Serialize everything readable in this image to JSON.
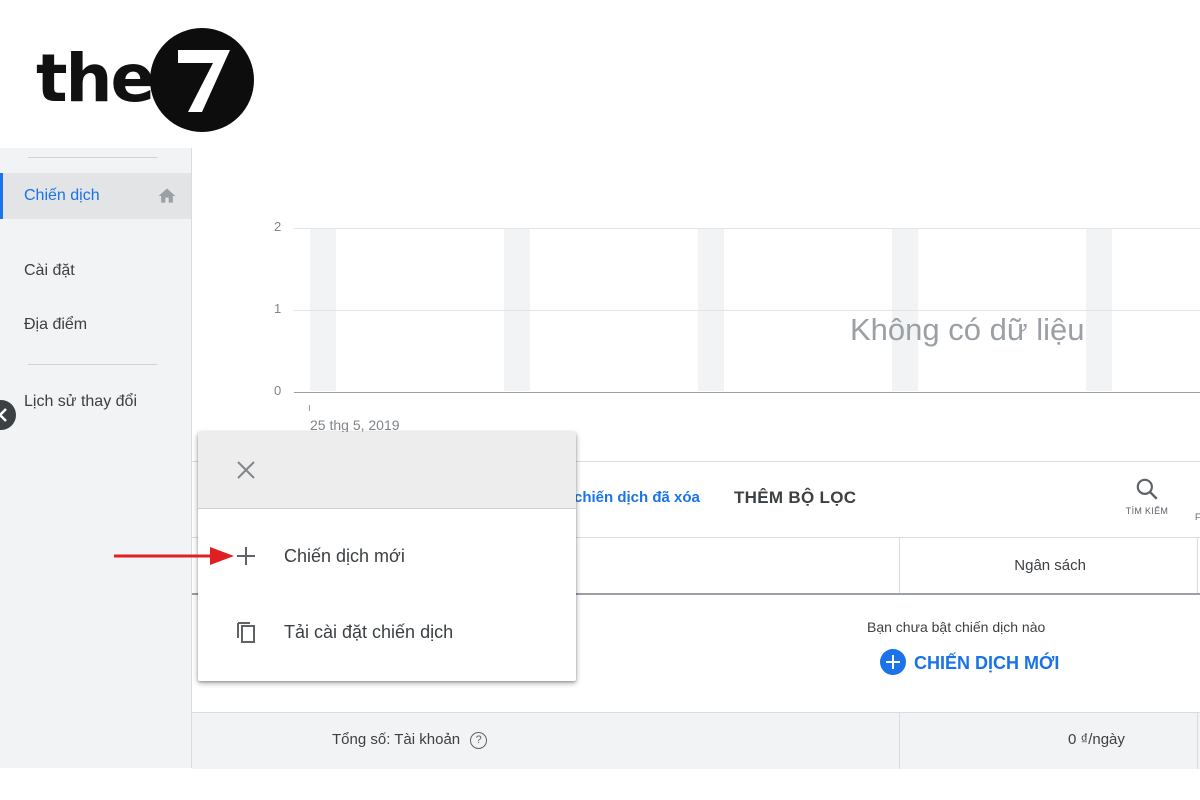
{
  "logo": {
    "text": "the",
    "circle_glyph": "7"
  },
  "sidebar": {
    "items": [
      {
        "label": "Chiến dịch",
        "active": true,
        "icon": "home-icon"
      },
      {
        "label": "Cài đặt"
      },
      {
        "label": "Địa điểm"
      },
      {
        "label": "Lịch sử thay đổi"
      }
    ]
  },
  "chart": {
    "y_ticks": [
      "2",
      "1",
      "0"
    ],
    "x_label": "25 thg 5, 2019",
    "no_data": "Không có dữ liệu"
  },
  "chart_data": {
    "type": "line",
    "x": [
      "25 thg 5, 2019"
    ],
    "ylim": [
      0,
      2
    ],
    "series": [],
    "grid": true
  },
  "filters": {
    "link": "chiến dịch đã xóa",
    "add_filter": "THÊM BỘ LỌC",
    "search_label": "TÌM KIẾM",
    "more_label": "F"
  },
  "table": {
    "budget_header": "Ngân sách",
    "empty_message": "Bạn chưa bật chiến dịch nào",
    "new_campaign": "CHIẾN DỊCH MỚI",
    "total_label": "Tổng số: Tài khoản",
    "help_glyph": "?",
    "total_budget": "0 ₫/ngày"
  },
  "menu": {
    "close_icon": "close-icon",
    "items": [
      {
        "label": "Chiến dịch mới",
        "icon": "plus-icon"
      },
      {
        "label": "Tải cài đặt chiến dịch",
        "icon": "copy-icon"
      }
    ]
  },
  "colors": {
    "accent": "#1a73e8",
    "arrow": "#e02020",
    "sidebar_bg": "#f1f3f4"
  }
}
